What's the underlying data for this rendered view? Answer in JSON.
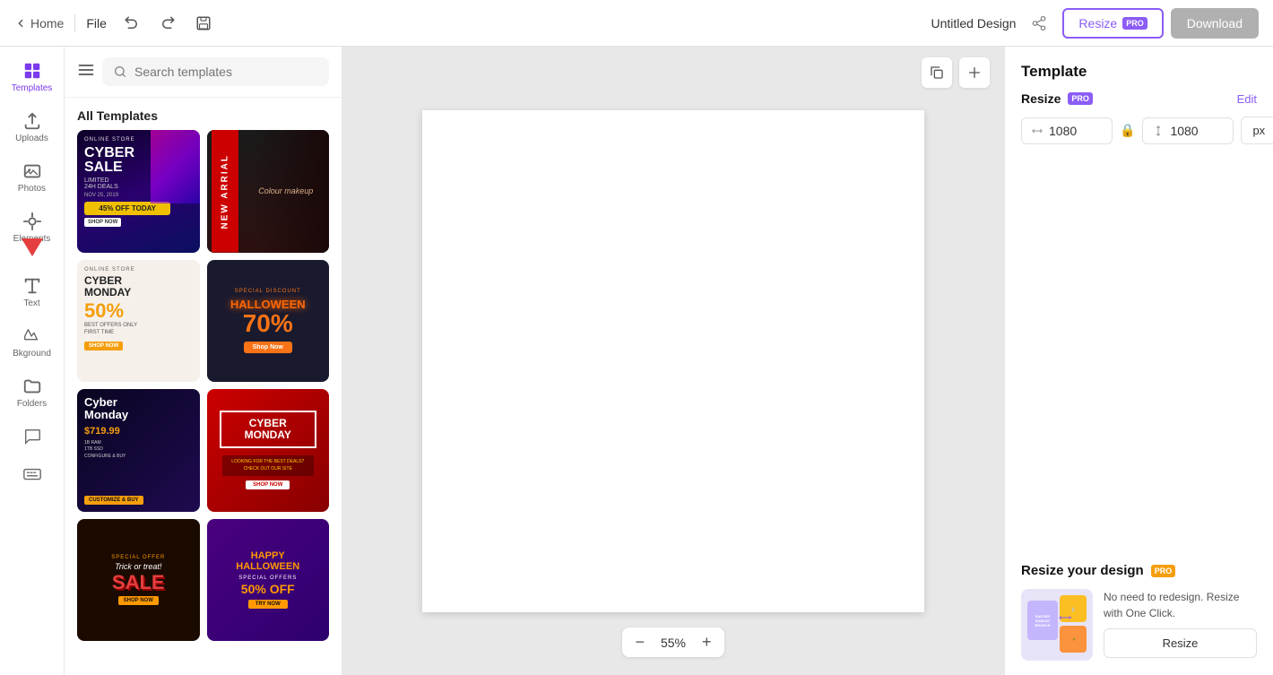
{
  "topbar": {
    "home_label": "Home",
    "file_label": "File",
    "title": "Untitled Design",
    "resize_label": "Resize",
    "download_label": "Download",
    "pro_label": "PRO"
  },
  "search": {
    "placeholder": "Search templates"
  },
  "panel": {
    "all_templates_label": "All Templates"
  },
  "templates": [
    {
      "id": "t1",
      "style": "tc1",
      "tag": "ONLINE STORE",
      "title": "CYBER SALE",
      "sub": "LIMITED 24H DEALS",
      "extra": "45% OFF TODAY",
      "badge": "SHOP NOW"
    },
    {
      "id": "t2",
      "style": "tc2",
      "tag": "",
      "title": "NEW ARRIAL",
      "sub": "Colour makeup",
      "extra": "",
      "badge": ""
    },
    {
      "id": "t3",
      "style": "tc3",
      "tag": "ONLINE STORE",
      "title": "CYBER MONDAY",
      "percent": "50%",
      "sub": "BEST OFFERS ONLY FIRST TIME",
      "badge": "SHOP NOW"
    },
    {
      "id": "t4",
      "style": "tc4",
      "tag": "Special Discount",
      "title": "HALLOWEEN",
      "percent": "70%",
      "badge": "Shop Now"
    },
    {
      "id": "t5",
      "style": "tc5",
      "tag": "",
      "title": "Cyber Monday",
      "price": "$719.99",
      "sub": "1B RAM  1TB SSD  CONFIGURE & BUY",
      "badge": "CUSTOMIZE & BUY"
    },
    {
      "id": "t6",
      "style": "tc6",
      "tag": "",
      "title": "CYBER MONDAY",
      "sub": "",
      "extra": "",
      "badge": "SHOP NOW"
    },
    {
      "id": "t7",
      "style": "tc7",
      "tag": "SPECIAL OFFER",
      "title": "Trick or treat!",
      "percent": "SALE",
      "badge": "SHOP NOW"
    },
    {
      "id": "t8",
      "style": "tc8",
      "tag": "",
      "title": "HAPPY HALLOWEEN",
      "sub": "SPECIAL OFFERS",
      "percent": "50% OFF",
      "badge": "TRY NOW"
    }
  ],
  "right_panel": {
    "title": "Template",
    "resize_label": "Resize",
    "pro_label": "PRO",
    "edit_label": "Edit",
    "width": "1080",
    "height": "1080",
    "unit": "px",
    "resize_design_title": "Resize your design",
    "resize_desc": "No need to redesign. Resize with One Click.",
    "resize_btn": "Resize"
  },
  "canvas": {
    "zoom_level": "55%"
  }
}
